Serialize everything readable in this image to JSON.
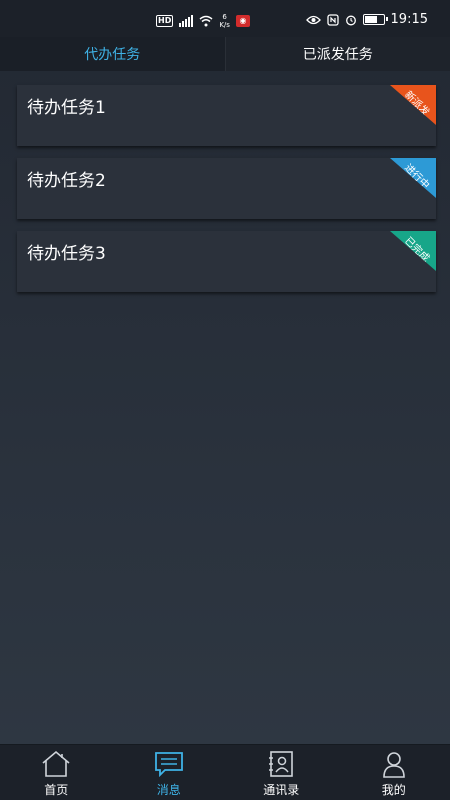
{
  "status_bar": {
    "hd": "HD",
    "net_speed_value": "6",
    "net_speed_unit": "K/s",
    "time": "19:15",
    "icons": [
      "hd-icon",
      "signal-icon",
      "wifi-icon",
      "app-notification-icon",
      "eye-icon",
      "nfc-icon",
      "alarm-icon",
      "battery-icon"
    ]
  },
  "tabs": [
    {
      "label": "代办任务",
      "active": true
    },
    {
      "label": "已派发任务",
      "active": false
    }
  ],
  "tasks": [
    {
      "title": "待办任务1",
      "status": "新派发",
      "status_color": "#e8541c"
    },
    {
      "title": "待办任务2",
      "status": "进行中",
      "status_color": "#2d9ad6"
    },
    {
      "title": "待办任务3",
      "status": "已完成",
      "status_color": "#17a689"
    }
  ],
  "bottom_nav": [
    {
      "label": "首页",
      "icon": "home-icon",
      "active": false
    },
    {
      "label": "消息",
      "icon": "message-icon",
      "active": true
    },
    {
      "label": "通讯录",
      "icon": "contacts-icon",
      "active": false
    },
    {
      "label": "我的",
      "icon": "profile-icon",
      "active": false
    }
  ],
  "colors": {
    "accent": "#3fb2e6",
    "background": "#2a323d"
  }
}
